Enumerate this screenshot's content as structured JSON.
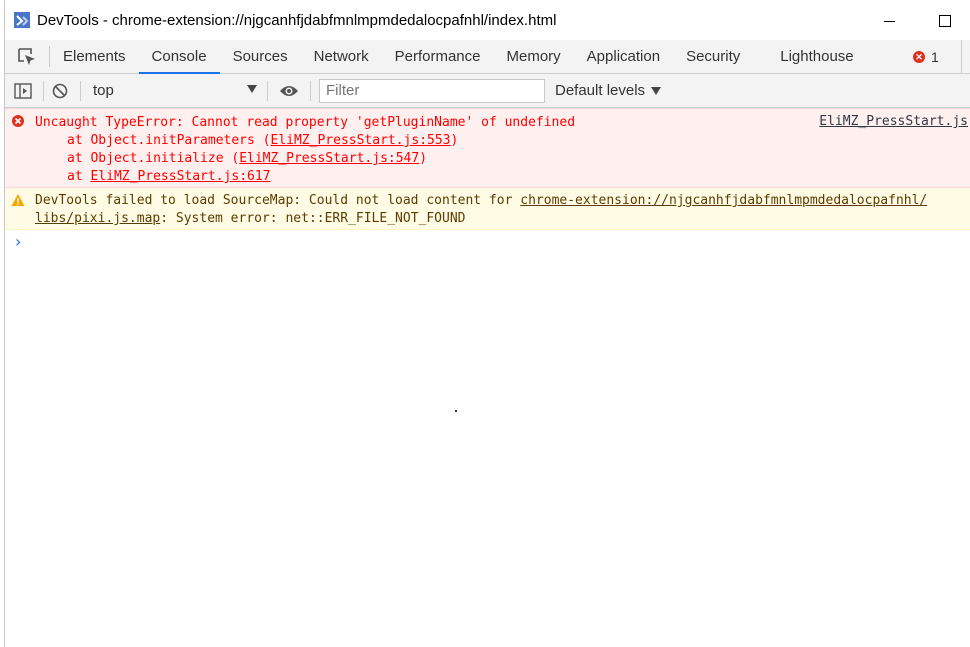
{
  "window": {
    "title": "DevTools - chrome-extension://njgcanhfjdabfmnlmpmdedalocpafnhl/index.html"
  },
  "tabs": [
    {
      "label": "Elements"
    },
    {
      "label": "Console"
    },
    {
      "label": "Sources"
    },
    {
      "label": "Network"
    },
    {
      "label": "Performance"
    },
    {
      "label": "Memory"
    },
    {
      "label": "Application"
    },
    {
      "label": "Security"
    },
    {
      "label": "Lighthouse"
    }
  ],
  "active_tab": "Console",
  "error_count": "1",
  "toolbar": {
    "context": "top",
    "filter_placeholder": "Filter",
    "levels": "Default levels"
  },
  "messages": {
    "error": {
      "text": "Uncaught TypeError: Cannot read property 'getPluginName' of undefined",
      "source": "EliMZ_PressStart.js",
      "stack": [
        {
          "prefix": "at Object.initParameters (",
          "link": "EliMZ_PressStart.js:553",
          "suffix": ")"
        },
        {
          "prefix": "at Object.initialize (",
          "link": "EliMZ_PressStart.js:547",
          "suffix": ")"
        },
        {
          "prefix": "at ",
          "link": "EliMZ_PressStart.js:617",
          "suffix": ""
        }
      ]
    },
    "warning": {
      "prefix": "DevTools failed to load SourceMap: Could not load content for ",
      "link": "chrome-extension://njgcanhfjdabfmnlmpmdedalocpafnhl/",
      "link2": "libs/pixi.js.map",
      "suffix": ": System error: net::ERR_FILE_NOT_FOUND"
    }
  },
  "colors": {
    "accent": "#1a73e8",
    "error_text": "#ff0000",
    "error_bg": "#fff0f0",
    "warn_bg": "#fffbe5",
    "warn_text": "#5c3c00"
  }
}
